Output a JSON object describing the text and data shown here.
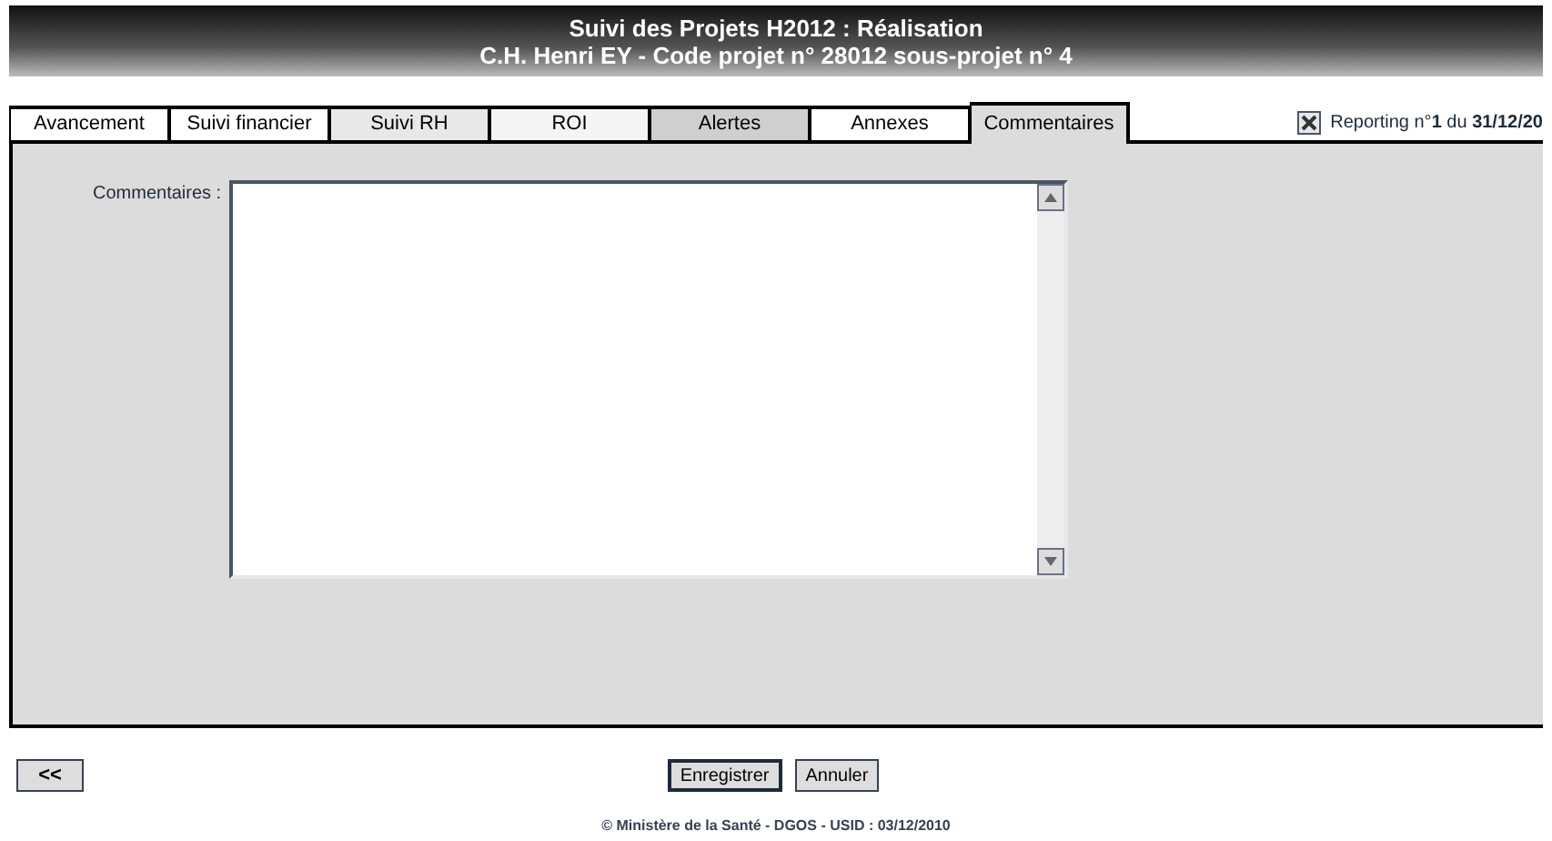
{
  "header": {
    "title": "Suivi des Projets H2012 : Réalisation",
    "subtitle": "C.H. Henri EY - Code projet n° 28012 sous-projet n° 4"
  },
  "tabs": [
    {
      "label": "Avancement",
      "selected": false,
      "color": "#ffffff"
    },
    {
      "label": "Suivi financier",
      "selected": false,
      "color": "#ffffff"
    },
    {
      "label": "Suivi RH",
      "selected": false,
      "color": "#e8e8e8"
    },
    {
      "label": "ROI",
      "selected": false,
      "color": "#f4f4f4"
    },
    {
      "label": "Alertes",
      "selected": false,
      "color": "#cfcfcf"
    },
    {
      "label": "Annexes",
      "selected": false,
      "color": "#ffffff"
    },
    {
      "label": "Commentaires",
      "selected": true,
      "color": "#dcdcdc"
    }
  ],
  "reporting": "Reporting n°**1** du **31/12/20**",
  "comment_field": {
    "label": "Commentaires :"
  },
  "buttons": {
    "back": "<<",
    "save": "Enregistrer",
    "cancel": "Annuler"
  },
  "footer": "© Ministère de la Santé - DGOS - USID : 03/12/2010"
}
